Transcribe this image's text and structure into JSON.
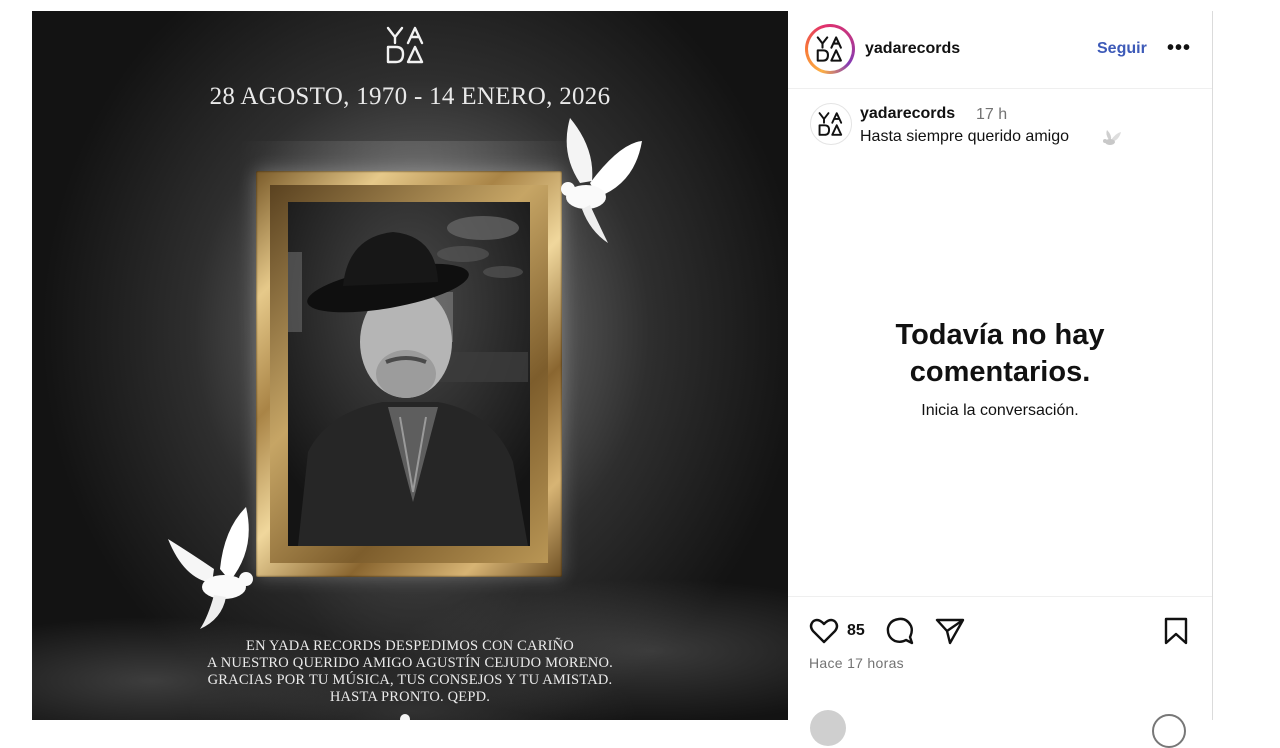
{
  "post_image": {
    "logo_icon": "yada-logo-icon",
    "dates": "28 AGOSTO, 1970 - 14 ENERO, 2026",
    "message_lines": [
      "EN YADA RECORDS DESPEDIMOS CON CARIÑO",
      "A NUESTRO QUERIDO AMIGO AGUSTÍN CEJUDO MORENO.",
      "GRACIAS POR TU MÚSICA, TUS CONSEJOS Y TU AMISTAD.",
      "HASTA PRONTO. QEPD."
    ]
  },
  "header": {
    "username": "yadarecords",
    "follow_label": "Seguir",
    "more_label": "•••"
  },
  "caption": {
    "username": "yadarecords",
    "time": "17 h",
    "text": "Hasta siempre querido amigo",
    "emoji_icon": "dove-icon"
  },
  "comments_empty": {
    "title_line1": "Todavía no hay",
    "title_line2": "comentarios.",
    "subtitle": "Inicia la conversación."
  },
  "actions": {
    "like_count": "85",
    "time_ago": "Hace 17 horas"
  },
  "colors": {
    "follow": "#3d5ab8",
    "muted": "#737373",
    "text": "#111111"
  }
}
